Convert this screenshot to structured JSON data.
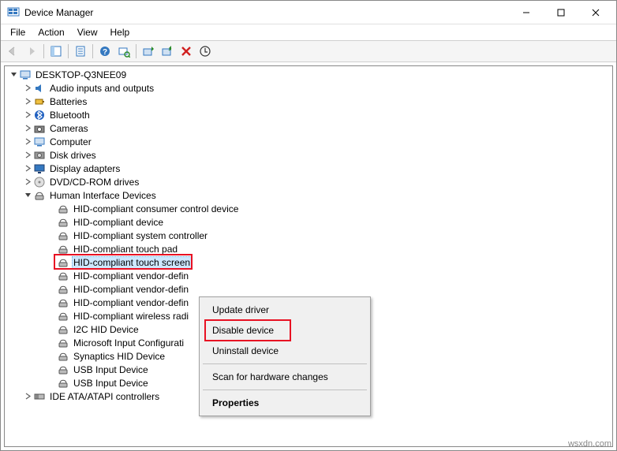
{
  "window": {
    "title": "Device Manager"
  },
  "menubar": [
    "File",
    "Action",
    "View",
    "Help"
  ],
  "tree": {
    "root": "DESKTOP-Q3NEE09",
    "categories": [
      {
        "label": "Audio inputs and outputs",
        "icon": "audio"
      },
      {
        "label": "Batteries",
        "icon": "battery"
      },
      {
        "label": "Bluetooth",
        "icon": "bluetooth"
      },
      {
        "label": "Cameras",
        "icon": "camera"
      },
      {
        "label": "Computer",
        "icon": "computer"
      },
      {
        "label": "Disk drives",
        "icon": "disk"
      },
      {
        "label": "Display adapters",
        "icon": "display"
      },
      {
        "label": "DVD/CD-ROM drives",
        "icon": "dvd"
      },
      {
        "label": "Human Interface Devices",
        "icon": "hid",
        "expanded": true,
        "children": [
          "HID-compliant consumer control device",
          "HID-compliant device",
          "HID-compliant system controller",
          "HID-compliant touch pad",
          "HID-compliant touch screen",
          "HID-compliant vendor-defin",
          "HID-compliant vendor-defin",
          "HID-compliant vendor-defin",
          "HID-compliant wireless radi",
          "I2C HID Device",
          "Microsoft Input Configurati",
          "Synaptics HID Device",
          "USB Input Device",
          "USB Input Device"
        ],
        "selected_index": 4
      },
      {
        "label": "IDE ATA/ATAPI controllers",
        "icon": "ide"
      }
    ]
  },
  "context_menu": {
    "items": [
      {
        "label": "Update driver"
      },
      {
        "label": "Disable device",
        "highlight": true
      },
      {
        "label": "Uninstall device"
      },
      {
        "sep": true
      },
      {
        "label": "Scan for hardware changes"
      },
      {
        "sep": true
      },
      {
        "label": "Properties",
        "bold": true
      }
    ]
  },
  "watermark": "wsxdn.com"
}
